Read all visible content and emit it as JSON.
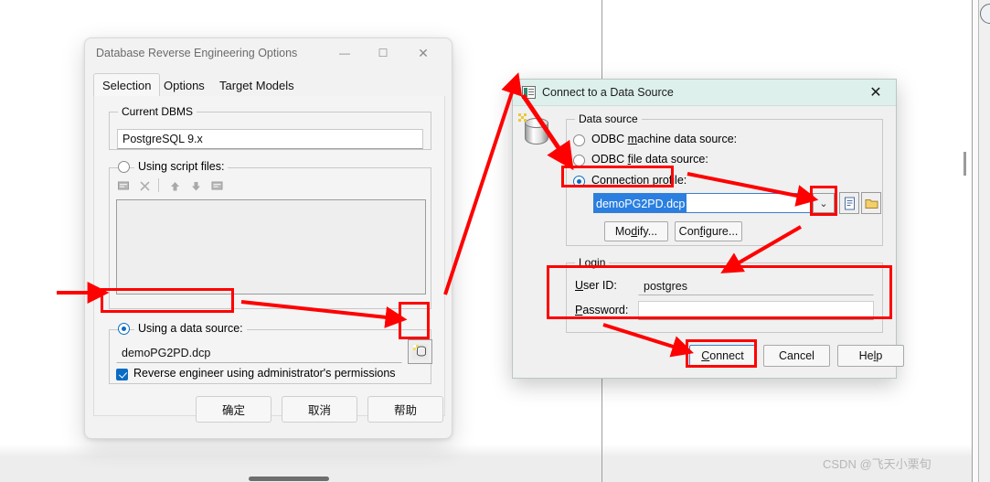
{
  "left_dialog": {
    "title": "Database Reverse Engineering Options",
    "caption_buttons": [
      {
        "name": "minimize",
        "glyph": "—"
      },
      {
        "name": "maximize",
        "glyph": "☐"
      },
      {
        "name": "close",
        "glyph": "✕"
      }
    ],
    "tabs": [
      {
        "label": "Selection",
        "active": true
      },
      {
        "label": "Options",
        "active": false
      },
      {
        "label": "Target Models",
        "active": false
      }
    ],
    "current_dbms": {
      "legend": "Current DBMS",
      "value": "PostgreSQL 9.x"
    },
    "using_script_files": {
      "label": "Using script files:",
      "selected": false,
      "toolbar_icons": [
        "add-script-icon",
        "delete-icon",
        "move-up-icon",
        "move-down-icon",
        "edit-script-icon"
      ]
    },
    "using_data_source": {
      "label": "Using a data source:",
      "selected": true,
      "value": "demoPG2PD.dcp",
      "browse_icon": "database-browse-icon"
    },
    "admin_checkbox": {
      "label": "Reverse engineer using administrator's permissions",
      "checked": true
    },
    "buttons": [
      {
        "label": "确定",
        "name": "ok-button"
      },
      {
        "label": "取消",
        "name": "cancel-button"
      },
      {
        "label": "帮助",
        "name": "help-button"
      }
    ]
  },
  "right_dialog": {
    "title": "Connect to a Data Source",
    "close_glyph": "✕",
    "window_icon": "data-source-icon",
    "side_icon": "database-cylinder-icon",
    "data_source": {
      "legend": "Data source",
      "options": [
        {
          "label_pre": "ODBC ",
          "label_accel": "m",
          "label_post": "achine data source:",
          "selected": false,
          "name": "radio-odbc-machine"
        },
        {
          "label_pre": "ODBC ",
          "label_accel": "f",
          "label_post": "ile data source:",
          "selected": false,
          "name": "radio-odbc-file"
        },
        {
          "label_pre": "Connection ",
          "label_accel": "p",
          "label_post": "rofile:",
          "selected": true,
          "name": "radio-connection-profile"
        }
      ],
      "profile_value": "demoPG2PD.dcp",
      "dropdown_glyph": "⌄",
      "new_icon": "new-file-icon",
      "browse_icon": "folder-open-icon",
      "modify_pre": "Mo",
      "modify_accel": "d",
      "modify_post": "ify...",
      "configure_pre": "Con",
      "configure_accel": "f",
      "configure_post": "igure..."
    },
    "login": {
      "legend": "Login",
      "user_id_pre": "",
      "user_id_accel": "U",
      "user_id_post": "ser ID:",
      "user_id_value": "postgres",
      "password_accel": "P",
      "password_post": "assword:",
      "password_value": ""
    },
    "buttons": [
      {
        "label_pre": "",
        "label_accel": "C",
        "label_post": "onnect",
        "name": "connect-button",
        "default": true
      },
      {
        "label_pre": "Cancel",
        "label_accel": "",
        "label_post": "",
        "name": "cancel-button",
        "default": false
      },
      {
        "label_pre": "He",
        "label_accel": "l",
        "label_post": "p",
        "name": "help-button",
        "default": false
      }
    ]
  },
  "watermark": {
    "text": "CSDN @飞天小栗旬"
  },
  "annotation": {
    "color": "#ff0000"
  }
}
